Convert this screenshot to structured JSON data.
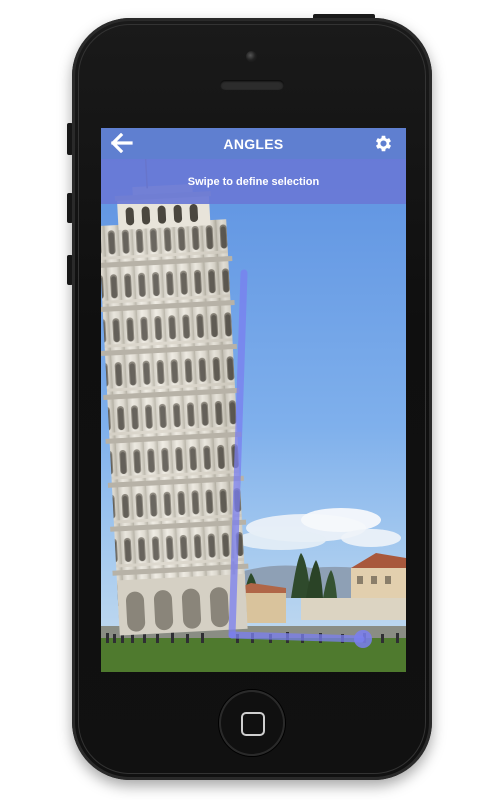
{
  "app": {
    "title": "ANGLES",
    "instruction": "Swipe to define selection"
  },
  "icons": {
    "back": "back-arrow-icon",
    "settings": "gear-icon"
  },
  "colors": {
    "app_bar": "#5f7fd0",
    "instruction_bar": "#6978d6",
    "selection_line": "#7a7ff0",
    "sky": "#6e9fe0"
  }
}
